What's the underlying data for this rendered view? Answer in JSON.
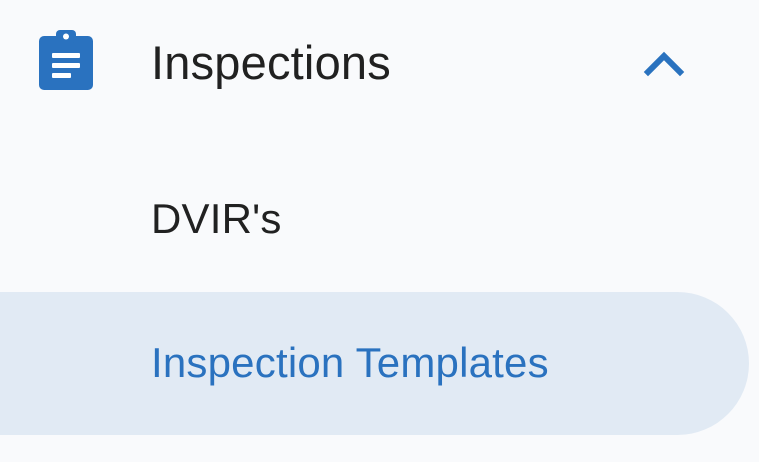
{
  "nav": {
    "group": {
      "label": "Inspections",
      "icon": "clipboard-icon",
      "toggle_icon": "chevron-up-icon",
      "expanded": true,
      "accent_color": "#2a72bf"
    },
    "items": [
      {
        "label": "DVIR's",
        "active": false
      },
      {
        "label": "Inspection Templates",
        "active": true
      }
    ],
    "colors": {
      "background": "#f9fafc",
      "active_background": "#e1eaf4",
      "active_text": "#2a72bf",
      "text": "#212121"
    }
  }
}
